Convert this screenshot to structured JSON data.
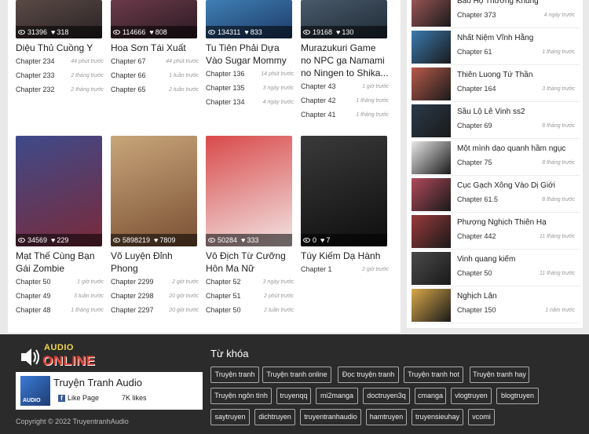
{
  "grid": {
    "row1": [
      {
        "views": "31396",
        "likes": "318",
        "title": "Diệu Thủ Cuồng Y",
        "chapters": [
          [
            "Chapter 234",
            "44 phút trước"
          ],
          [
            "Chapter 233",
            "2 tháng trước"
          ],
          [
            "Chapter 232",
            "2 tháng trước"
          ]
        ],
        "color1": "#5a4a44",
        "color2": "#2a2226"
      },
      {
        "views": "114666",
        "likes": "808",
        "title": "Hoa Sơn Tái Xuất",
        "chapters": [
          [
            "Chapter 67",
            "44 phút trước"
          ],
          [
            "Chapter 66",
            "1 tuần trước"
          ],
          [
            "Chapter 65",
            "2 tuần trước"
          ]
        ],
        "color1": "#6c3a4a",
        "color2": "#2a1a22"
      },
      {
        "views": "134311",
        "likes": "833",
        "title": "Tu Tiên Phải Dựa Vào Sugar Mommy",
        "chapters": [
          [
            "Chapter 136",
            "14 phút trước"
          ],
          [
            "Chapter 135",
            "3 ngày trước"
          ],
          [
            "Chapter 134",
            "4 ngày trước"
          ]
        ],
        "color1": "#3f7fb5",
        "color2": "#1d3a66"
      },
      {
        "views": "19168",
        "likes": "130",
        "title": "Murazukuri Game no NPC ga Namami no Ningen to Shika...",
        "chapters": [
          [
            "Chapter 43",
            "1 giờ trước"
          ],
          [
            "Chapter 42",
            "1 tháng trước"
          ],
          [
            "Chapter 41",
            "1 tháng trước"
          ]
        ],
        "color1": "#4a5a6a",
        "color2": "#1e2a36"
      }
    ],
    "row2": [
      {
        "views": "34569",
        "likes": "229",
        "title": "Mạt Thế Cùng Bạn Gái Zombie",
        "chapters": [
          [
            "Chapter 50",
            "1 giờ trước"
          ],
          [
            "Chapter 49",
            "3 tuần trước"
          ],
          [
            "Chapter 48",
            "1 tháng trước"
          ]
        ],
        "color1": "#3e4a8a",
        "color2": "#7a2a3a"
      },
      {
        "views": "5898219",
        "likes": "7809",
        "title": "Võ Luyện Đỉnh Phong",
        "chapters": [
          [
            "Chapter 2299",
            "2 giờ trước"
          ],
          [
            "Chapter 2298",
            "20 giờ trước"
          ],
          [
            "Chapter 2297",
            "20 giờ trước"
          ]
        ],
        "color1": "#c9a67a",
        "color2": "#7a5034"
      },
      {
        "views": "50284",
        "likes": "333",
        "title": "Vô Địch Từ Cưỡng Hôn Ma Nữ",
        "chapters": [
          [
            "Chapter 52",
            "3 ngày trước"
          ],
          [
            "Chapter 51",
            "2 phút trước"
          ],
          [
            "Chapter 50",
            "2 tuần trước"
          ]
        ],
        "color1": "#d94a4a",
        "color2": "#f2e4e4"
      },
      {
        "views": "0",
        "likes": "7",
        "title": "Túy Kiếm Dạ Hành",
        "chapters": [
          [
            "Chapter 1",
            "2 giờ trước"
          ]
        ],
        "color1": "#3a3a3a",
        "color2": "#0e0e0e"
      }
    ]
  },
  "sidebar": [
    {
      "title": "Bảo Hộ Thương Khung",
      "chapter": "Chapter 373",
      "time": "4 ngày trước",
      "color": "#a45a5a"
    },
    {
      "title": "Nhất Niệm Vĩnh Hằng",
      "chapter": "Chapter 61",
      "time": "1 tháng trước",
      "color": "#3a7ab0"
    },
    {
      "title": "Thiên Luong Tứ Thần",
      "chapter": "Chapter 164",
      "time": "3 tháng trước",
      "color": "#b85a4a"
    },
    {
      "title": "Sầu Lộ Lê Vinh ss2",
      "chapter": "Chapter 69",
      "time": "8 tháng trước",
      "color": "#2a3a4a"
    },
    {
      "title": "Một mình dạo quanh hầm ngục",
      "chapter": "Chapter 75",
      "time": "8 tháng trước",
      "color": "#e8e8e8"
    },
    {
      "title": "Cục Gạch Xông Vào Dị Giới",
      "chapter": "Chapter 61.5",
      "time": "8 tháng trước",
      "color": "#b04a5a"
    },
    {
      "title": "Phượng Nghịch Thiên Hạ",
      "chapter": "Chapter 442",
      "time": "11 tháng trước",
      "color": "#9a3a3a"
    },
    {
      "title": "Vinh quang kiếm",
      "chapter": "Chapter 50",
      "time": "11 tháng trước",
      "color": "#4a4a4a"
    },
    {
      "title": "Nghịch Lân",
      "chapter": "Chapter 150",
      "time": "1 năm trước",
      "color": "#d8a84a"
    }
  ],
  "footer": {
    "logo_audio": "AUDIO",
    "logo_online": "ONLINE",
    "fb_name": "Truyện Tranh Audio",
    "fb_thumb": "AUDIO",
    "fb_like": "Like Page",
    "fb_likes": "7K likes",
    "copyright": "Copyright © 2022 TruyentranhAudio",
    "keywords_title": "Từ khóa",
    "keywords": [
      "Truyện tranh",
      "Truyện tranh online",
      "Đọc truyện tranh",
      "Truyện tranh hot",
      "Truyện tranh hay",
      "Truyện ngôn tình",
      "truyenqq",
      "mi2manga",
      "doctruyen3q",
      "cmanga",
      "vlogtruyen",
      "blogtruyen",
      "saytruyen",
      "dichtruyen",
      "truyentranhaudio",
      "hamtruyen",
      "truyensieuhay",
      "vcomi"
    ]
  }
}
